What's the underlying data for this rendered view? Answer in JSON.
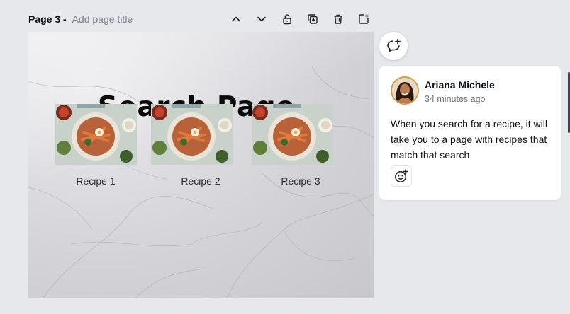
{
  "page_header": {
    "label": "Page 3 - ",
    "title_placeholder": "Add page title",
    "icons": [
      "chevron-up-icon",
      "chevron-down-icon",
      "lock-icon",
      "duplicate-icon",
      "trash-icon",
      "add-page-icon"
    ]
  },
  "slide": {
    "title": "Search Page",
    "recipes": [
      {
        "label": "Recipe 1"
      },
      {
        "label": "Recipe 2"
      },
      {
        "label": "Recipe 3"
      }
    ]
  },
  "comment": {
    "author": "Ariana Michele",
    "time": "34 minutes ago",
    "text": "When you search for a recipe, it will take you to a page with recipes that match that search"
  },
  "colors": {
    "app_background": "#e7e8ec",
    "accent": "#c99f4a"
  }
}
